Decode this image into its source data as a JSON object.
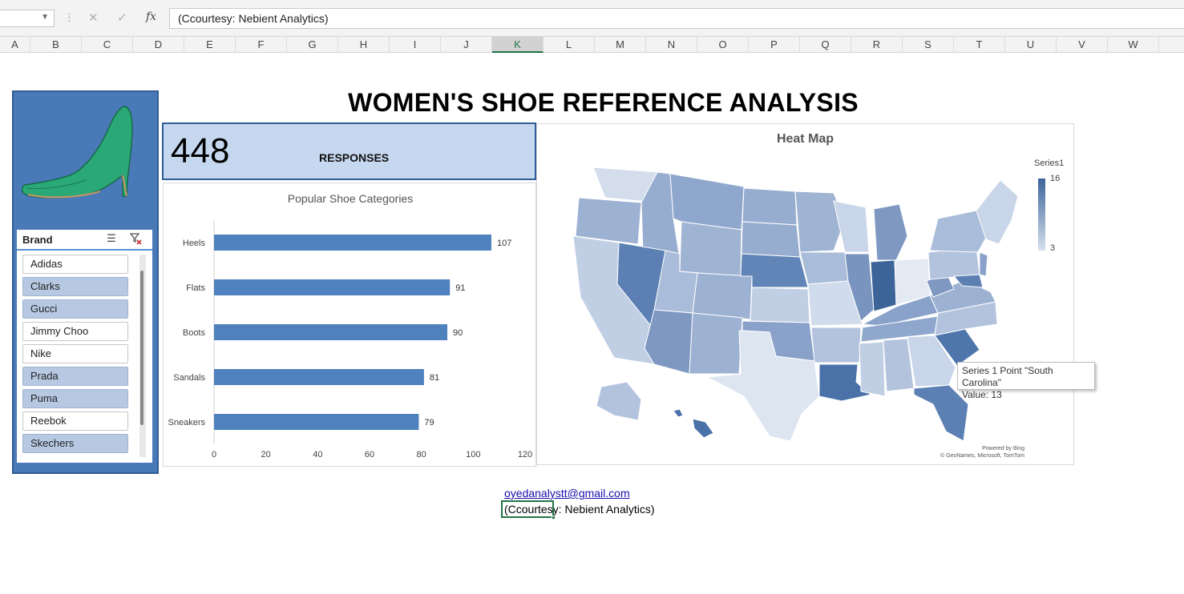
{
  "formula_bar": {
    "name_box": "",
    "cancel_icon": "close-icon",
    "enter_icon": "check-icon",
    "fx_label": "fx",
    "content": "(Ccourtesy: Nebient Analytics)"
  },
  "columns": [
    "A",
    "B",
    "C",
    "D",
    "E",
    "F",
    "G",
    "H",
    "I",
    "J",
    "K",
    "L",
    "M",
    "N",
    "O",
    "P",
    "Q",
    "R",
    "S",
    "T",
    "U",
    "V",
    "W"
  ],
  "active_column": "K",
  "dashboard": {
    "title": "WOMEN'S SHOE REFERENCE ANALYSIS",
    "kpi": {
      "value": "448",
      "label": "RESPONSES"
    },
    "slicer": {
      "title": "Brand",
      "multi_select_icon": "multi-select-icon",
      "clear_filter_icon": "clear-filter-icon",
      "items": [
        {
          "label": "Adidas",
          "selected": false
        },
        {
          "label": "Clarks",
          "selected": true
        },
        {
          "label": "Gucci",
          "selected": true
        },
        {
          "label": "Jimmy Choo",
          "selected": false
        },
        {
          "label": "Nike",
          "selected": false
        },
        {
          "label": "Prada",
          "selected": true
        },
        {
          "label": "Puma",
          "selected": true
        },
        {
          "label": "Reebok",
          "selected": false
        },
        {
          "label": "Skechers",
          "selected": true
        }
      ]
    },
    "heat_map": {
      "title": "Heat Map",
      "legend_title": "Series1",
      "legend_max": "16",
      "legend_min": "3",
      "credit_line1": "Powered by Bing",
      "credit_line2": "© GeoNames, Microsoft, TomTom",
      "tooltip_line1": "Series 1 Point \"South Carolina\"",
      "tooltip_line2": "Value: 13",
      "colors": {
        "low": "#d6e0ef",
        "high": "#3c6499"
      }
    },
    "footer": {
      "email": "oyedanalystt@gmail.com",
      "credit": "(Ccourtesy: Nebient Analytics)"
    }
  },
  "chart_data": {
    "type": "bar",
    "orientation": "horizontal",
    "title": "Popular Shoe Categories",
    "categories": [
      "Heels",
      "Flats",
      "Boots",
      "Sandals",
      "Sneakers"
    ],
    "values": [
      107,
      91,
      90,
      81,
      79
    ],
    "xlim": [
      0,
      120
    ],
    "xticks": [
      0,
      20,
      40,
      60,
      80,
      100,
      120
    ],
    "bar_color": "#4e81bd",
    "data_labels": true,
    "grid": false
  }
}
